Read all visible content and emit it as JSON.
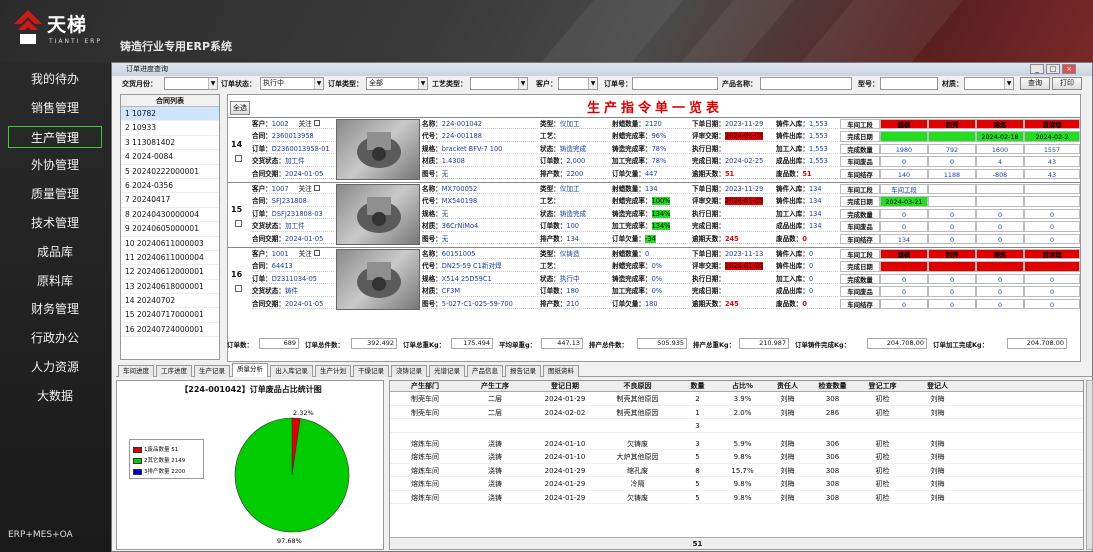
{
  "app": {
    "logo_title": "天梯",
    "logo_sub": "TIANTI ERP",
    "system_title": "铸造行业专用ERP系统",
    "footer": "ERP+MES+OA"
  },
  "nav": [
    "我的待办",
    "销售管理",
    "生产管理",
    "外协管理",
    "质量管理",
    "技术管理",
    "成品库",
    "原料库",
    "财务管理",
    "行政办公",
    "人力资源",
    "大数据"
  ],
  "window": {
    "title": "订单进度查询",
    "btn_min": "_",
    "btn_max": "□",
    "btn_close": "×"
  },
  "filters": {
    "delivery_month_label": "交货月份：",
    "order_status_label": "订单状态：",
    "order_status_value": "执行中",
    "order_type_label": "订单类型：",
    "order_type_value": "全部",
    "process_type_label": "工艺类型：",
    "customer_label": "客户：",
    "order_no_label": "订单号：",
    "product_name_label": "产品名称：",
    "model_label": "型号：",
    "material_label": "材质：",
    "query_btn": "查询",
    "print_btn": "打印"
  },
  "order_list": {
    "header": "合同列表",
    "items": [
      "1 10782",
      "2 10933",
      "3 113081402",
      "4 2024-0084",
      "5 20240222000001",
      "6 2024-0356",
      "7 20240417",
      "8 20240430000004",
      "9 20240605000001",
      "10 20240611000003",
      "11 20240611000004",
      "12 20240612000001",
      "13 20240618000001",
      "14 20240702",
      "15 20240717000001",
      "16 20240724000001"
    ]
  },
  "main": {
    "title": "生产指令单一览表",
    "select_all": "全选"
  },
  "cards": [
    {
      "no": "14",
      "customer": "1002",
      "follow": "关注",
      "contract": "2360013958",
      "order": "D2360013958-01",
      "delivery_status": "加工件",
      "contract_delivery": "2024-01-05",
      "name": "224-001042",
      "code": "224-001188",
      "spec": "bracket BFV-7 100",
      "material": "1.4308",
      "drawing": "无",
      "type": "仪加工",
      "craft": "",
      "state": "铸造完成",
      "order_qty": "2,000",
      "prod_qty": "2200",
      "wax_qty": "2120",
      "wax_rate": "96%",
      "cast_rate": "78%",
      "mach_rate": "78%",
      "owe": "447",
      "order_date": "2023-11-29",
      "review": "2024-01-05",
      "exec_date": "",
      "finish_date": "2024-02-25",
      "overdue": "51",
      "cast_in": "1,553",
      "cast_out": "1,553",
      "mach_in": "1,553",
      "prod_out": "1,553",
      "scrap": "51",
      "g_proc": [
        "蜡模",
        "制壳",
        "熔炼",
        "前清理"
      ],
      "g_done_date": [
        "",
        "",
        "2024-02-18",
        "2024-02-2"
      ],
      "g_done_qty": [
        "1980",
        "792",
        "1600",
        "1557"
      ],
      "g_scrap": [
        "0",
        "0",
        "4",
        "43"
      ],
      "g_stock": [
        "140",
        "1188",
        "-808",
        "43"
      ]
    },
    {
      "no": "15",
      "customer": "1007",
      "follow": "关注",
      "contract": "SFJ231808",
      "order": "DSFJ231808-03",
      "delivery_status": "加工件",
      "contract_delivery": "2024-01-05",
      "name": "MX700052",
      "code": "MX540198",
      "spec": "无",
      "material": "36CrNiMo4",
      "drawing": "无",
      "type": "仪加工",
      "craft": "",
      "state": "铸造完成",
      "order_qty": "100",
      "prod_qty": "134",
      "wax_qty": "134",
      "wax_rate": "100%",
      "cast_rate": "134%",
      "mach_rate": "134%",
      "owe": "-34",
      "order_date": "2023-11-29",
      "review": "2024-01-05",
      "exec_date": "",
      "finish_date": "",
      "overdue": "245",
      "cast_in": "134",
      "cast_out": "134",
      "mach_in": "134",
      "prod_out": "134",
      "scrap": "0",
      "g_proc": [
        "车间工段",
        "",
        "",
        "",
        ""
      ],
      "g_done_date": [
        "2024-03-21",
        "",
        "",
        ""
      ],
      "g_done_qty": [
        "0",
        "0",
        "0",
        "0"
      ],
      "g_scrap": [
        "0",
        "0",
        "0",
        "0"
      ],
      "g_stock": [
        "134",
        "0",
        "0",
        "0"
      ]
    },
    {
      "no": "16",
      "customer": "1001",
      "follow": "关注",
      "contract": "64413",
      "order": "D2311034-05",
      "delivery_status": "铸件",
      "contract_delivery": "2024-01-05",
      "name": "60151005",
      "code": "DN25-59 C1新对焊",
      "spec": "X514 25D59C1",
      "material": "CF3M",
      "drawing": "5-027-C1-025-59-700",
      "type": "仪铸造",
      "craft": "",
      "state": "执行中",
      "order_qty": "180",
      "prod_qty": "210",
      "wax_qty": "0",
      "wax_rate": "0%",
      "cast_rate": "0%",
      "mach_rate": "0%",
      "owe": "180",
      "order_date": "2023-11-13",
      "review": "2024-01-05",
      "exec_date": "",
      "finish_date": "",
      "overdue": "245",
      "cast_in": "0",
      "cast_out": "0",
      "mach_in": "0",
      "prod_out": "0",
      "scrap": "0",
      "g_proc": [
        "蜡模",
        "制壳",
        "熔炼",
        "前清理"
      ],
      "g_done_date": [
        "",
        "",
        "",
        ""
      ],
      "g_done_qty": [
        "0",
        "0",
        "0",
        "0"
      ],
      "g_scrap": [
        "0",
        "0",
        "0",
        "0"
      ],
      "g_stock": [
        "0",
        "0",
        "0",
        "0"
      ]
    }
  ],
  "card_labels": {
    "customer": "客户：",
    "contract": "合同：",
    "order": "订单：",
    "delivery_status": "交货状态：",
    "contract_delivery": "合同交期：",
    "name": "名称：",
    "code": "代号：",
    "spec": "规格：",
    "material": "材质：",
    "drawing": "图号：",
    "type": "类型：",
    "craft": "工艺：",
    "state": "状态：",
    "order_qty": "订单数：",
    "prod_qty": "排产数：",
    "wax_qty": "射蜡数量：",
    "wax_rate": "射蜡完成率：",
    "cast_rate": "铸造完成率：",
    "mach_rate": "加工完成率：",
    "owe": "订单欠量：",
    "order_date": "下单日期：",
    "review": "评审交期：",
    "exec_date": "执行日期：",
    "finish_date": "完成日期：",
    "overdue": "逾期天数：",
    "cast_in": "铸件入库：",
    "cast_out": "铸件出库：",
    "mach_in": "加工入库：",
    "prod_out": "成品出库：",
    "scrap": "废品数：",
    "g_row_proc": "车间工段",
    "g_row_date": "完成日期",
    "g_row_qty": "完成数量",
    "g_row_scrap": "车间废品",
    "g_row_stock": "车间结存"
  },
  "summary": {
    "l1": "订单数：",
    "v1": "689",
    "l2": "订单总件数：",
    "v2": "392.492",
    "l3": "订单总重Kg：",
    "v3": "175.494",
    "l4": "平均单重g：",
    "v4": "447.13",
    "l5": "排产总件数：",
    "v5": "505.935",
    "l6": "排产总重Kg：",
    "v6": "210.987",
    "l7": "订单铸件完成Kg：",
    "v7": "204.708.00",
    "l8": "订单加工完成Kg：",
    "v8": "204.708.00"
  },
  "tabs": [
    "车间进度",
    "工序进度",
    "生产记录",
    "质量分析",
    "出入库记录",
    "生产计划",
    "干燥记录",
    "浇铸记录",
    "光谱记录",
    "产品信息",
    "报告记录",
    "图纸资料"
  ],
  "pie": {
    "title": "【224-001042】订单废品占比统计图",
    "label_small": "2.32%",
    "label_big": "97.68%",
    "legend": [
      "1废品数量 51",
      "2其它数量 2149",
      "3排产数量 2200"
    ],
    "chart_data": {
      "type": "pie",
      "categories": [
        "1废品数量",
        "2其它数量",
        "3排产数量"
      ],
      "values": [
        51,
        2149,
        0
      ],
      "colors": [
        "#e00000",
        "#00cc00",
        "#0000cc"
      ]
    }
  },
  "grid": {
    "headers": [
      "产生部门",
      "产生工序",
      "登记日期",
      "不良原因",
      "数量",
      "占比%",
      "责任人",
      "检查数量",
      "登记工序",
      "登记人"
    ],
    "rows": [
      [
        "制壳车间",
        "二层",
        "2024-01-29",
        "制壳其他原因",
        "2",
        "3.9%",
        "刘梅",
        "308",
        "初检",
        "刘梅"
      ],
      [
        "制壳车间",
        "二层",
        "2024-02-02",
        "制壳其他原因",
        "1",
        "2.0%",
        "刘梅",
        "286",
        "初检",
        "刘梅"
      ],
      [
        "",
        "",
        "",
        "",
        "3",
        "",
        "",
        "",
        "",
        ""
      ],
      [
        "熔炼车间",
        "浇铸",
        "2024-01-10",
        "欠铸废",
        "3",
        "5.9%",
        "刘梅",
        "306",
        "初检",
        "刘梅"
      ],
      [
        "熔炼车间",
        "浇铸",
        "2024-01-10",
        "大炉其他原因",
        "5",
        "9.8%",
        "刘梅",
        "306",
        "初检",
        "刘梅"
      ],
      [
        "熔炼车间",
        "浇铸",
        "2024-01-29",
        "缩孔废",
        "8",
        "15.7%",
        "刘梅",
        "308",
        "初检",
        "刘梅"
      ],
      [
        "熔炼车间",
        "浇铸",
        "2024-01-29",
        "冷隔",
        "5",
        "9.8%",
        "刘梅",
        "308",
        "初检",
        "刘梅"
      ],
      [
        "熔炼车间",
        "浇铸",
        "2024-01-29",
        "欠铸废",
        "5",
        "9.8%",
        "刘梅",
        "308",
        "初检",
        "刘梅"
      ]
    ],
    "total": "51"
  }
}
